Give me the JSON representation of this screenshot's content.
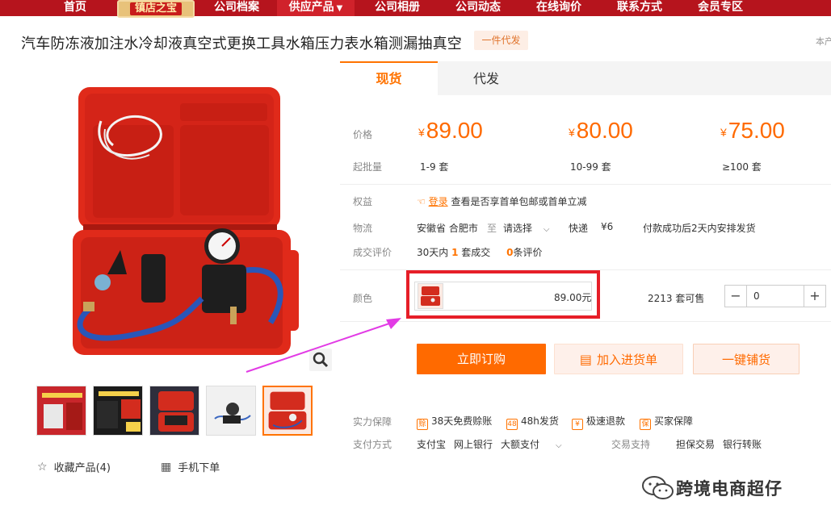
{
  "nav": {
    "items": [
      "首页",
      "公司档案",
      "供应产品",
      "公司相册",
      "公司动态",
      "在线询价",
      "联系方式",
      "会员专区"
    ],
    "badge": "镇店之宝"
  },
  "product": {
    "title": "汽车防冻液加注水冷却液真空式更换工具水箱压力表水箱测漏抽真空",
    "badge": "一件代发",
    "side_note": "本产"
  },
  "tabs": [
    "现货",
    "代发"
  ],
  "pricing": {
    "price_label": "价格",
    "moq_label": "起批量",
    "currency": "¥",
    "tiers": [
      {
        "price": "89.00",
        "qty": "1-9 套"
      },
      {
        "price": "80.00",
        "qty": "10-99 套"
      },
      {
        "price": "75.00",
        "qty": "≥100 套"
      }
    ]
  },
  "rights": {
    "label": "权益",
    "login": "登录",
    "text": "查看是否享首单包邮或首单立减"
  },
  "logistics": {
    "label": "物流",
    "origin": "安徽省 合肥市",
    "to": "至",
    "dest": "请选择",
    "express": "快递",
    "fee": "¥6",
    "ship_note": "付款成功后2天内安排发货"
  },
  "reviews": {
    "label": "成交评价",
    "prefix": "30天内",
    "sold": "1",
    "sold_suffix": "套成交",
    "count": "0",
    "count_suffix": "条评价"
  },
  "sku": {
    "label": "颜色",
    "price": "89.00元",
    "stock": "2213 套可售",
    "quantity": "0",
    "minus": "−",
    "plus": "+"
  },
  "actions": {
    "buy": "立即订购",
    "cart": "加入进货单",
    "dist": "一键铺货"
  },
  "guarantee": {
    "label": "实力保障",
    "items": [
      "38天免费赊账",
      "48h发货",
      "极速退款",
      "买家保障"
    ]
  },
  "payment": {
    "label": "支付方式",
    "methods": [
      "支付宝",
      "网上银行",
      "大额支付"
    ],
    "support_label": "交易支持",
    "support": [
      "担保交易",
      "银行转账"
    ]
  },
  "links": {
    "favorite": "收藏产品(4)",
    "mobile": "手机下单"
  },
  "watermark": "跨境电商超仔",
  "colors": {
    "nav_bg": "#b6141d",
    "accent": "#ff6a00",
    "highlight_box": "#e61e28",
    "arrow": "#e23be5"
  }
}
